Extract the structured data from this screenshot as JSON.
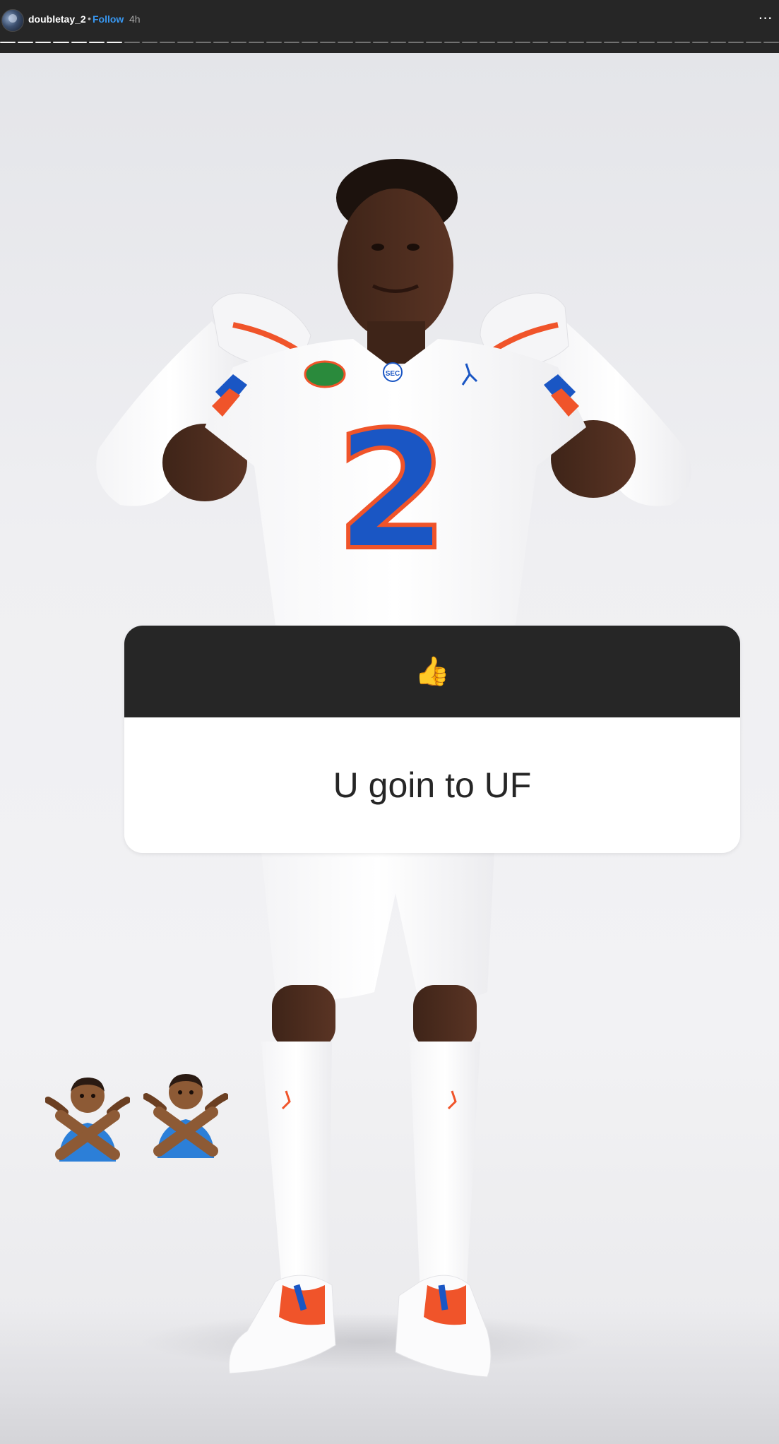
{
  "header": {
    "username": "doubletay_2",
    "separator": "•",
    "follow_label": "Follow",
    "time": "4h",
    "more_icon": "more-options-icon"
  },
  "progress": {
    "total_segments": 44,
    "completed_segments": 7
  },
  "story": {
    "jersey_number": "2",
    "sticker": {
      "emoji": "👍",
      "emoji_name": "thumbs-up-icon",
      "question": "U goin to UF"
    },
    "overlay_emojis": [
      "person-gesturing-no",
      "person-gesturing-no"
    ]
  },
  "colors": {
    "header_bg": "#262626",
    "follow_blue": "#3897f0",
    "jersey_blue": "#1a56c4",
    "jersey_orange": "#f0542a",
    "sticker_dark": "#262626"
  }
}
